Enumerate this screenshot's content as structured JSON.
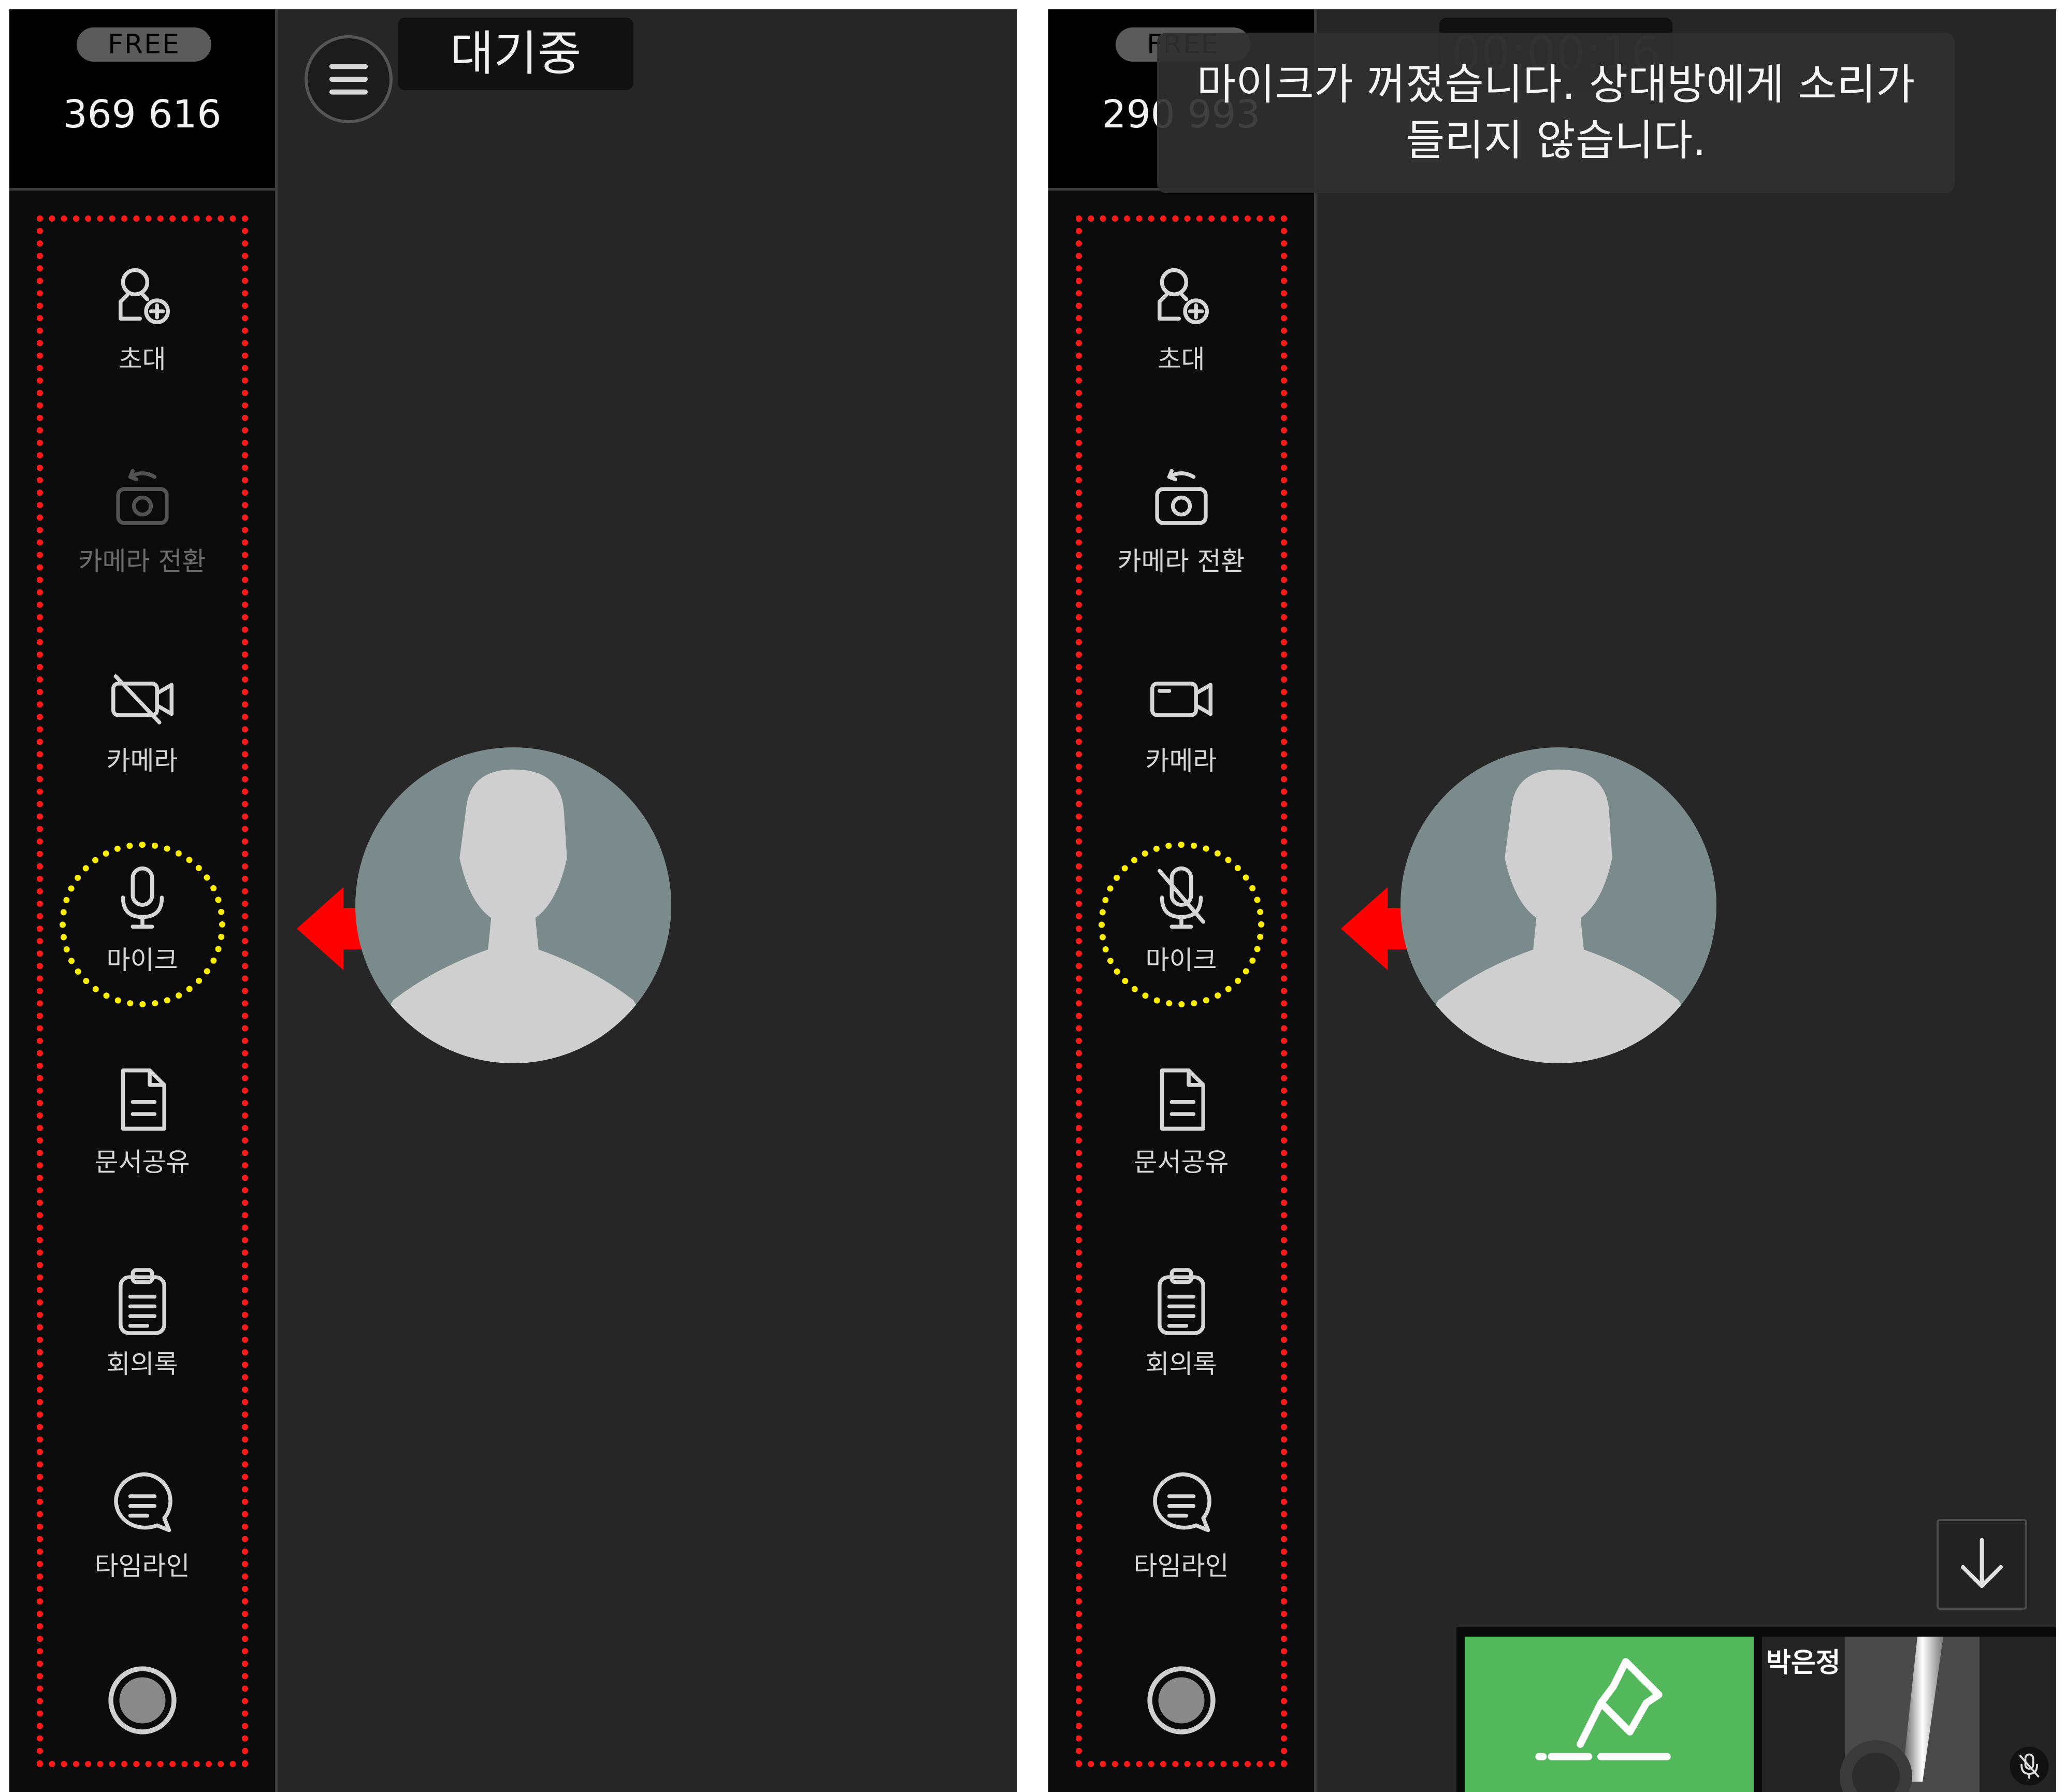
{
  "left_panel": {
    "plan_badge": "FREE",
    "room_code": "369 616",
    "status": "대기중",
    "menu": [
      {
        "label": "초대",
        "icon": "user-plus-icon"
      },
      {
        "label": "카메라 전환",
        "icon": "camera-switch-icon",
        "disabled": true
      },
      {
        "label": "카메라",
        "icon": "camera-off-icon"
      },
      {
        "label": "마이크",
        "icon": "microphone-icon",
        "highlighted": true
      },
      {
        "label": "문서공유",
        "icon": "document-icon"
      },
      {
        "label": "회의록",
        "icon": "clipboard-icon"
      },
      {
        "label": "타임라인",
        "icon": "chat-bubble-icon"
      }
    ]
  },
  "right_panel": {
    "plan_badge": "FREE",
    "room_code": "290 993",
    "timer": "00:00:16",
    "toast": "마이크가 꺼졌습니다. 상대방에게 소리가 들리지 않습니다.",
    "menu": [
      {
        "label": "초대",
        "icon": "user-plus-icon"
      },
      {
        "label": "카메라 전환",
        "icon": "camera-switch-icon"
      },
      {
        "label": "카메라",
        "icon": "camera-icon"
      },
      {
        "label": "마이크",
        "icon": "microphone-off-icon",
        "highlighted": true
      },
      {
        "label": "문서공유",
        "icon": "document-icon"
      },
      {
        "label": "회의록",
        "icon": "clipboard-icon"
      },
      {
        "label": "타임라인",
        "icon": "chat-bubble-icon"
      }
    ],
    "participant": {
      "name": "박은정",
      "mic_muted": true
    }
  },
  "colors": {
    "background": "#262626",
    "sidebar": "#0b0b0b",
    "annotation_box": "#ff1a1a",
    "annotation_circle": "#ffee00",
    "arrow": "#ff0000",
    "pin_tile": "#53b85b",
    "avatar_bg": "#7b8b8b",
    "avatar_figure": "#cfcfcf"
  }
}
